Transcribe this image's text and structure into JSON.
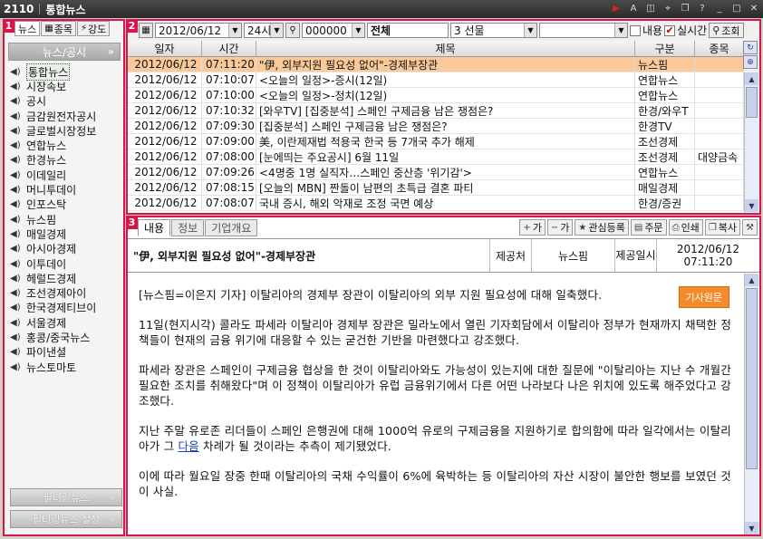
{
  "window": {
    "code": "2110",
    "title": "통합뉴스"
  },
  "left": {
    "badge": "1",
    "tabs": [
      {
        "label": "뉴스"
      },
      {
        "label": "종목"
      },
      {
        "label": "강도"
      }
    ],
    "header": "뉴스/공시",
    "sources": [
      "통합뉴스",
      "시장속보",
      "공시",
      "금감원전자공시",
      "글로벌시장정보",
      "연합뉴스",
      "한경뉴스",
      "이데일리",
      "머니투데이",
      "인포스탁",
      "뉴스핌",
      "매일경제",
      "아시아경제",
      "이투데이",
      "헤럴드경제",
      "조선경제아이",
      "한국경제티브이",
      "서울경제",
      "홍콩/중국뉴스",
      "파이낸셜",
      "뉴스토마토"
    ],
    "filter_news": "필터링뉴스",
    "filter_settings": "필터링뉴스 설정"
  },
  "list": {
    "badge": "2",
    "date": "2012/06/12",
    "period": "24시",
    "code": "000000",
    "market": "전체",
    "category": "3  선물",
    "content_label": "내용",
    "realtime_label": "실시간",
    "query_label": "조회",
    "columns": [
      "일자",
      "시간",
      "제목",
      "구분",
      "종목"
    ],
    "rows": [
      {
        "date": "2012/06/12",
        "time": "07:11:20",
        "title": "\"伊, 외부지원 필요성 없어\"-경제부장관",
        "source": "뉴스핌",
        "stock": ""
      },
      {
        "date": "2012/06/12",
        "time": "07:10:07",
        "title": "<오늘의 일정>-증시(12일)",
        "source": "연합뉴스",
        "stock": ""
      },
      {
        "date": "2012/06/12",
        "time": "07:10:00",
        "title": "<오늘의 일정>-정치(12일)",
        "source": "연합뉴스",
        "stock": ""
      },
      {
        "date": "2012/06/12",
        "time": "07:10:32",
        "title": "[와우TV] [집중분석] 스페인 구제금융 남은 쟁점은?",
        "source": "한경/와우T",
        "stock": ""
      },
      {
        "date": "2012/06/12",
        "time": "07:09:30",
        "title": "[집중분석] 스페인 구제금융 남은 쟁점은?",
        "source": "한경TV",
        "stock": ""
      },
      {
        "date": "2012/06/12",
        "time": "07:09:00",
        "title": "美, 이란제재법 적용국 한국 등 7개국 추가 해제",
        "source": "조선경제",
        "stock": ""
      },
      {
        "date": "2012/06/12",
        "time": "07:08:00",
        "title": "[눈에띄는 주요공시] 6월 11일",
        "source": "조선경제",
        "stock": "대양금속"
      },
      {
        "date": "2012/06/12",
        "time": "07:09:26",
        "title": "<4명중 1명 실직자…스페인 중산층 '위기감'>",
        "source": "연합뉴스",
        "stock": ""
      },
      {
        "date": "2012/06/12",
        "time": "07:08:15",
        "title": "[오늘의 MBN] 짠돌이 남편의 초특급 결혼 파티",
        "source": "매일경제",
        "stock": ""
      },
      {
        "date": "2012/06/12",
        "time": "07:08:07",
        "title": "국내 증시, 해외 악재로 조정 국면 예상",
        "source": "한경/증권",
        "stock": ""
      }
    ]
  },
  "article": {
    "badge": "3",
    "tabs": [
      "내용",
      "정보",
      "기업개요"
    ],
    "buttons": {
      "font_up": "가",
      "font_down": "가",
      "watch": "관심등록",
      "order": "주문",
      "print": "인쇄",
      "copy": "복사"
    },
    "title": "\"伊, 외부지원 필요성 없어\"-경제부장관",
    "provider_label": "제공처",
    "provider": "뉴스핌",
    "time_label": "제공일시",
    "date": "2012/06/12",
    "time": "07:11:20",
    "original_button": "기사원문",
    "paragraphs": [
      "[뉴스핌=이은지 기자] 이탈리아의 경제부 장관이 이탈리아의 외부 지원 필요성에 대해 일축했다.",
      "11일(현지시각) 콜라도 파세라 이탈리아 경제부 장관은 밀라노에서 열린 기자회담에서 이탈리아 정부가 현재까지 채택한 정책들이 현재의 금융 위기에 대응할 수 있는 굳건한 기반을 마련했다고 강조했다.",
      "파세라 장관은 스페인이 구제금융 협상을 한 것이 이탈리아와도 가능성이 있는지에 대한 질문에 \"이탈리아는 지난 수 개월간 필요한 조치를 취해왔다\"며 이 정책이 이탈리아가 유럽 금융위기에서 다른 어떤 나라보다 나은 위치에 있도록 해주었다고 강조했다.",
      "이에 따라 월요일 장중 한때 이탈리아의 국채 수익률이 6%에 육박하는 등 이탈리아의 자산 시장이 불안한 행보를 보였던 것이 사실."
    ],
    "p4_before": "지난 주말 유로존 리더들이 스페인 은행권에 대해 1000억 유로의 구제금융을 지원하기로 합의함에 따라 일각에서는 이탈리아가 그 ",
    "p4_link": "다음",
    "p4_after": " 차례가 될 것이라는 추측이 제기됐었다."
  }
}
